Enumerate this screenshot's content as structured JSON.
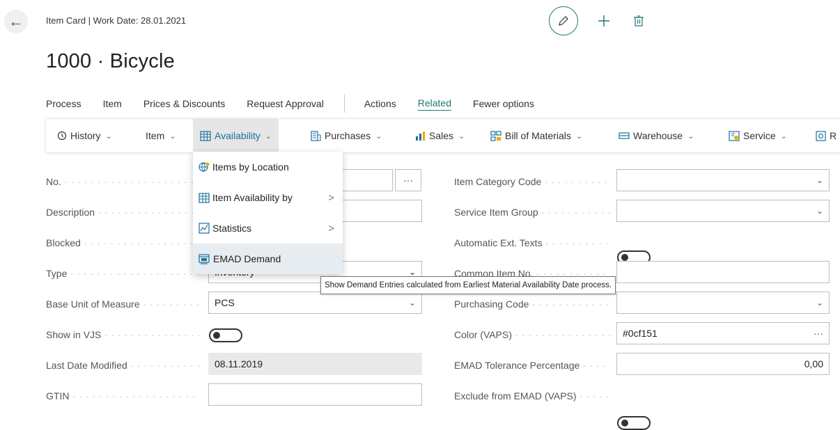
{
  "header": {
    "caption": "Item Card | Work Date: 28.01.2021",
    "title": "1000 · Bicycle"
  },
  "action_tabs": [
    "Process",
    "Item",
    "Prices & Discounts",
    "Request Approval",
    "Actions",
    "Related",
    "Fewer options"
  ],
  "action_tab_active": "Related",
  "sub_actions": [
    {
      "label": "History",
      "icon": "history-icon"
    },
    {
      "label": "Item",
      "icon": ""
    },
    {
      "label": "Availability",
      "icon": "availability-icon"
    },
    {
      "label": "Purchases",
      "icon": "purchases-icon"
    },
    {
      "label": "Sales",
      "icon": "sales-icon"
    },
    {
      "label": "Bill of Materials",
      "icon": "bill-of-materials-icon"
    },
    {
      "label": "Warehouse",
      "icon": "warehouse-icon"
    },
    {
      "label": "Service",
      "icon": "service-icon"
    },
    {
      "label": "R",
      "icon": "report-icon"
    }
  ],
  "availability_menu": [
    {
      "label": "Items by Location",
      "icon": "items-by-location-icon",
      "submenu": false
    },
    {
      "label": "Item Availability by",
      "icon": "availability-icon",
      "submenu": true
    },
    {
      "label": "Statistics",
      "icon": "statistics-icon",
      "submenu": true
    },
    {
      "label": "EMAD Demand",
      "icon": "emad-demand-icon",
      "submenu": false
    }
  ],
  "tooltip": "Show Demand Entries calculated from Earliest Material Availability Date process.",
  "left_fields": {
    "no": {
      "label": "No.",
      "value": ""
    },
    "description": {
      "label": "Description",
      "value": ""
    },
    "blocked": {
      "label": "Blocked"
    },
    "type": {
      "label": "Type",
      "value": "Inventory"
    },
    "base_unit": {
      "label": "Base Unit of Measure",
      "value": "PCS"
    },
    "show_in_vjs": {
      "label": "Show in VJS",
      "value": false
    },
    "last_modified": {
      "label": "Last Date Modified",
      "value": "08.11.2019"
    },
    "gtin": {
      "label": "GTIN",
      "value": ""
    }
  },
  "right_fields": {
    "item_category": {
      "label": "Item Category Code",
      "value": ""
    },
    "service_item_group": {
      "label": "Service Item Group",
      "value": ""
    },
    "auto_ext_texts": {
      "label": "Automatic Ext. Texts",
      "value": false
    },
    "common_item_no": {
      "label": "Common Item No.",
      "value": ""
    },
    "purchasing_code": {
      "label": "Purchasing Code",
      "value": ""
    },
    "color_vaps": {
      "label": "Color (VAPS)",
      "value": "#0cf151"
    },
    "emad_tolerance": {
      "label": "EMAD Tolerance Percentage",
      "value": "0,00"
    },
    "exclude_emad": {
      "label": "Exclude from EMAD (VAPS)",
      "value": false
    }
  },
  "colors": {
    "accent": "#1a7a75",
    "tooltip_border": "#767676",
    "menu_hover": "#e6ecf0"
  }
}
